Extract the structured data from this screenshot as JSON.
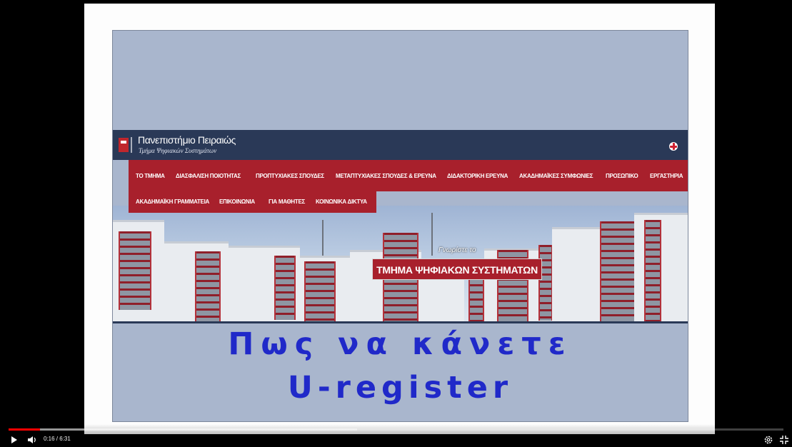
{
  "slide": {
    "site": {
      "university": "Πανεπιστήμιο Πειραιώς",
      "department": "Τμήμα Ψηφιακών Συστημάτων",
      "nav_row1": [
        "ΤΟ ΤΜΗΜΑ",
        "ΔΙΑΣΦΑΛΙΣΗ ΠΟΙΟΤΗΤΑΣ",
        "ΠΡΟΠΤΥΧΙΑΚΕΣ ΣΠΟΥΔΕΣ",
        "ΜΕΤΑΠΤΥΧΙΑΚΕΣ ΣΠΟΥΔΕΣ & ΕΡΕΥΝΑ",
        "ΔΙΔΑΚΤΟΡΙΚΗ ΕΡΕΥΝΑ",
        "ΑΚΑΔΗΜΑΪΚΕΣ ΣΥΜΦΩΝΙΕΣ",
        "ΠΡΟΣΩΠΙΚΟ",
        "ΕΡΓΑΣΤΗΡΙΑ"
      ],
      "nav_row2": [
        "ΑΚΑΔΗΜΑΪΚΗ ΓΡΑΜΜΑΤΕΙΑ",
        "ΕΠΙΚΟΙΝΩΝΙΑ",
        "ΓΙΑ ΜΑΘΗΤΕΣ",
        "ΚΟΙΝΩΝΙΚΑ ΔΙΚΤΥΑ"
      ],
      "hero_kicker": "Γνωρίστε το",
      "hero_title": "ΤΜΗΜΑ ΨΗΦΙΑΚΩΝ ΣΥΣΤΗΜΑΤΩΝ",
      "flag_icon": "uk-flag-icon"
    },
    "title_line1": "Πως να κάνετε",
    "title_line2": "U-register",
    "title_color": "#2029c9"
  },
  "player": {
    "time": "0:16 / 6:31",
    "played_fraction": 0.041,
    "buffered_fraction": 0.45,
    "progress_color": "#ff0000",
    "icons": [
      "play-icon",
      "volume-icon",
      "settings-icon",
      "fullscreen-icon"
    ]
  }
}
